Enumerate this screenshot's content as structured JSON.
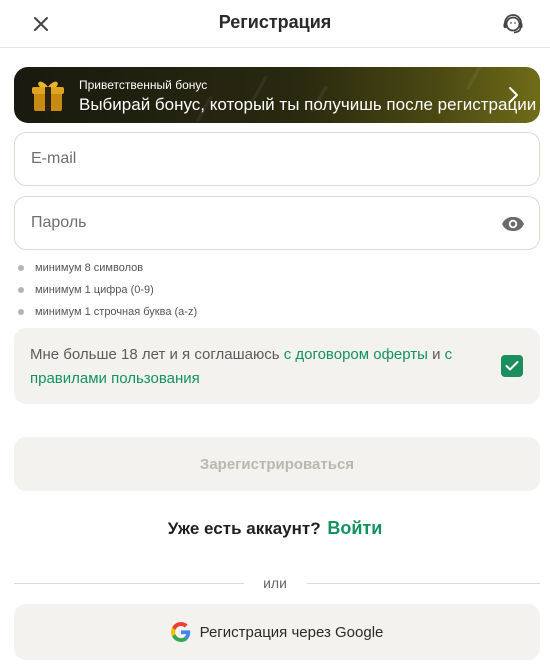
{
  "header": {
    "title": "Регистрация",
    "close_icon": "close-icon",
    "support_icon": "support-headset-icon"
  },
  "bonus": {
    "small_text": "Приветственный бонус",
    "main_text": "Выбирай бонус, который ты получишь после регистрации",
    "icon": "gift-icon"
  },
  "form": {
    "email_placeholder": "E-mail",
    "email_value": "",
    "password_placeholder": "Пароль",
    "password_value": ""
  },
  "password_rules": [
    "минимум 8 символов",
    "минимум 1 цифра (0-9)",
    "минимум 1 строчная буква (a-z)"
  ],
  "terms": {
    "text_before": "Мне больше 18 лет и я соглашаюсь ",
    "link_offer": "с договором оферты",
    "text_and": " и ",
    "link_rules": "с правилами пользования",
    "checked": true
  },
  "submit_label": "Зарегистрироваться",
  "login": {
    "question": "Уже есть аккаунт?",
    "link": "Войти"
  },
  "or_text": "или",
  "google": {
    "label": "Регистрация через Google"
  },
  "colors": {
    "accent_green": "#13925f",
    "checkbox_green": "#1b8e5e",
    "bonus_bg_dark": "#19190f",
    "bonus_bg_light": "#6f6c18"
  }
}
